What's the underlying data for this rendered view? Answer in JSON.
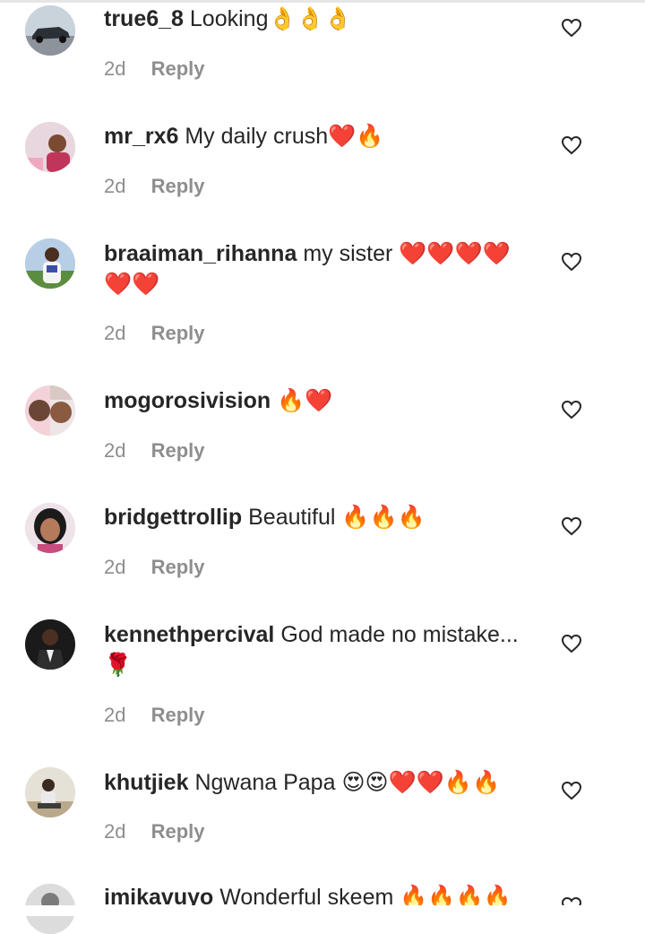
{
  "colors": {
    "text": "#262626",
    "meta": "#8e8e8e",
    "like_stroke": "#262626"
  },
  "comments": [
    {
      "username": "true6_8",
      "text": "Looking👌👌👌",
      "time": "2d",
      "reply": "Reply",
      "avatar": "car"
    },
    {
      "username": "mr_rx6",
      "text": "My daily crush❤️🔥",
      "time": "2d",
      "reply": "Reply",
      "avatar": "person-pink"
    },
    {
      "username": "braaiman_rihanna",
      "text": "my sister ❤️❤️❤️❤️❤️❤️",
      "time": "2d",
      "reply": "Reply",
      "avatar": "person-outdoor"
    },
    {
      "username": "mogorosivision",
      "text": "🔥❤️",
      "time": "2d",
      "reply": "Reply",
      "avatar": "kids"
    },
    {
      "username": "bridgettrollip",
      "text": "Beautiful 🔥🔥🔥",
      "time": "2d",
      "reply": "Reply",
      "avatar": "woman"
    },
    {
      "username": "kennethpercival",
      "text": "God made no mistake...🌹",
      "time": "2d",
      "reply": "Reply",
      "avatar": "man-dark"
    },
    {
      "username": "khutjiek",
      "text": "Ngwana Papa 😍😍❤️❤️🔥🔥",
      "time": "2d",
      "reply": "Reply",
      "avatar": "sitting"
    },
    {
      "username": "imikavuyo",
      "text": "Wonderful skeem 🔥🔥🔥🔥",
      "time": "",
      "reply": "",
      "avatar": "partial"
    }
  ]
}
